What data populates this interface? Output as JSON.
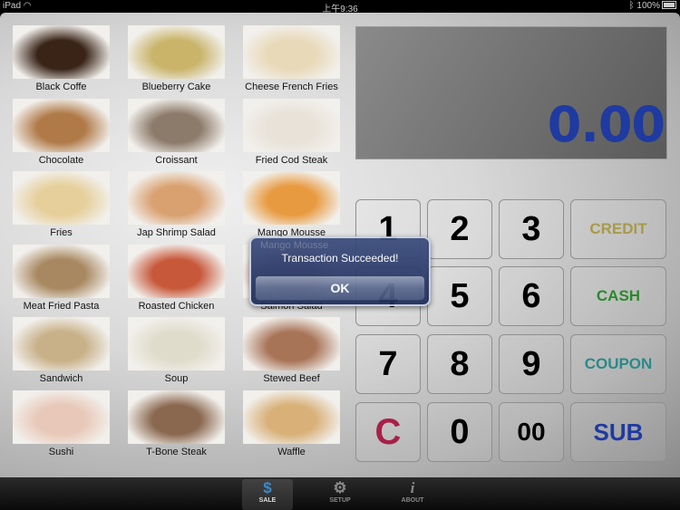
{
  "status_bar": {
    "device": "iPad",
    "time": "上午9:36",
    "battery": "100%"
  },
  "menu_items": [
    {
      "name": "Black Coffe",
      "color": "#3a2418"
    },
    {
      "name": "Blueberry Cake",
      "color": "#c9b46a"
    },
    {
      "name": "Cheese French Fries",
      "color": "#e8d9b8"
    },
    {
      "name": "Chocolate",
      "color": "#b07a48"
    },
    {
      "name": "Croissant",
      "color": "#8c7a6a"
    },
    {
      "name": "Fried Cod Steak",
      "color": "#e8e2d8"
    },
    {
      "name": "Fries",
      "color": "#e6cf9a"
    },
    {
      "name": "Jap Shrimp Salad",
      "color": "#d9a070"
    },
    {
      "name": "Mango Mousse",
      "color": "#e89a40"
    },
    {
      "name": "Meat Fried Pasta",
      "color": "#a88860"
    },
    {
      "name": "Roasted Chicken",
      "color": "#c8583a"
    },
    {
      "name": "Salmon Salad",
      "color": "#c89890"
    },
    {
      "name": "Sandwich",
      "color": "#c8b088"
    },
    {
      "name": "Soup",
      "color": "#e0dccc"
    },
    {
      "name": "Stewed Beef",
      "color": "#a87458"
    },
    {
      "name": "Sushi",
      "color": "#e8c8b8"
    },
    {
      "name": "T-Bone Steak",
      "color": "#8a6850"
    },
    {
      "name": "Waffle",
      "color": "#d8b078"
    }
  ],
  "display": {
    "amount": "0.00",
    "amount_color": "#1f3aa0"
  },
  "keypad": {
    "digits": [
      "1",
      "2",
      "3",
      "4",
      "5",
      "6",
      "7",
      "8",
      "9",
      "C",
      "0",
      "00"
    ],
    "clear_color": "#a8204a",
    "actions": [
      {
        "label": "CREDIT",
        "color": "#a89a4a"
      },
      {
        "label": "CASH",
        "color": "#2a8a2a"
      },
      {
        "label": "COUPON",
        "color": "#2a8a8a"
      },
      {
        "label": "SUB",
        "color": "#1f3aa0"
      }
    ]
  },
  "alert": {
    "ghost_text": "Mango Mousse",
    "message": "Transaction Succeeded!",
    "ok_label": "OK"
  },
  "tabs": [
    {
      "label": "SALE",
      "icon": "dollar-icon",
      "active": true
    },
    {
      "label": "SETUP",
      "icon": "gear-icon",
      "active": false
    },
    {
      "label": "ABOUT",
      "icon": "info-icon",
      "active": false
    }
  ]
}
